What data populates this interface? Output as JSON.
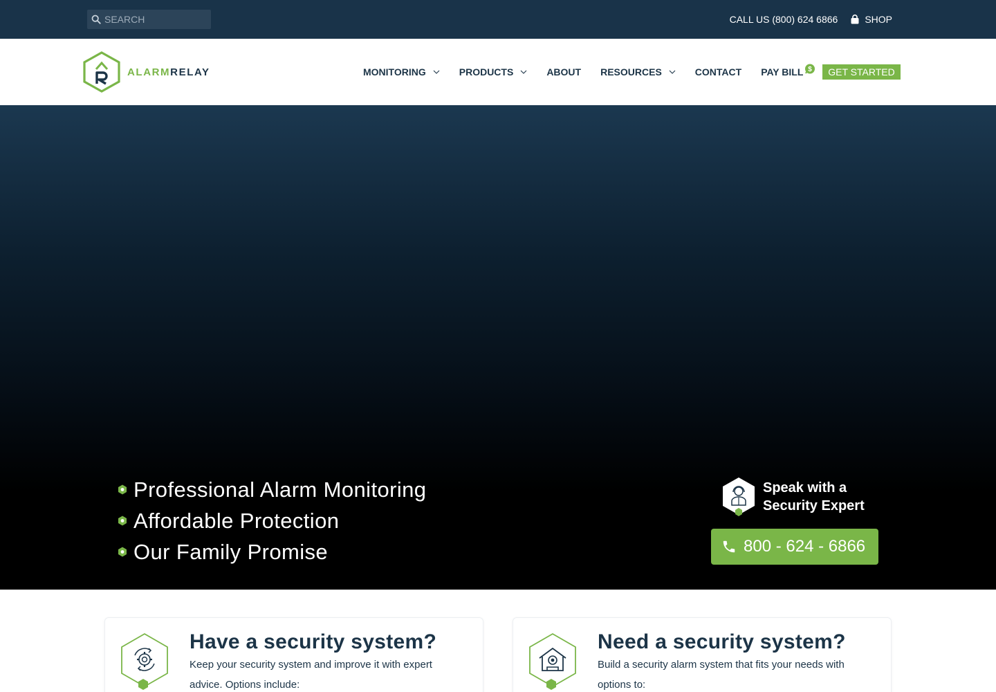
{
  "topbar": {
    "search_placeholder": "SEARCH",
    "call_us": "CALL US (800) 624 6866",
    "shop": "SHOP"
  },
  "brand": {
    "name_part1": "ALARM",
    "name_part2": "RELAY",
    "accent_color": "#7ab648",
    "dark_color": "#1c3447",
    "topbar_color": "#193349"
  },
  "nav": {
    "items": [
      {
        "label": "MONITORING",
        "dropdown": true
      },
      {
        "label": "PRODUCTS",
        "dropdown": true
      },
      {
        "label": "ABOUT",
        "dropdown": false
      },
      {
        "label": "RESOURCES",
        "dropdown": true
      },
      {
        "label": "CONTACT",
        "dropdown": false
      },
      {
        "label": "PAY BILL",
        "dropdown": false
      }
    ],
    "cta": "GET STARTED"
  },
  "hero": {
    "features": [
      "Professional Alarm Monitoring",
      "Affordable Protection",
      "Our Family Promise"
    ],
    "expert_line1": "Speak with a",
    "expert_line2": "Security Expert",
    "phone": "800 - 624 - 6866"
  },
  "cards": [
    {
      "title": "Have a security system?",
      "text": "Keep your security system and improve it with expert advice. Options include:",
      "icon": "gear-cycle-icon"
    },
    {
      "title": "Need a security system?",
      "text": "Build a security alarm system that fits your needs with options to:",
      "icon": "house-camera-icon"
    }
  ]
}
